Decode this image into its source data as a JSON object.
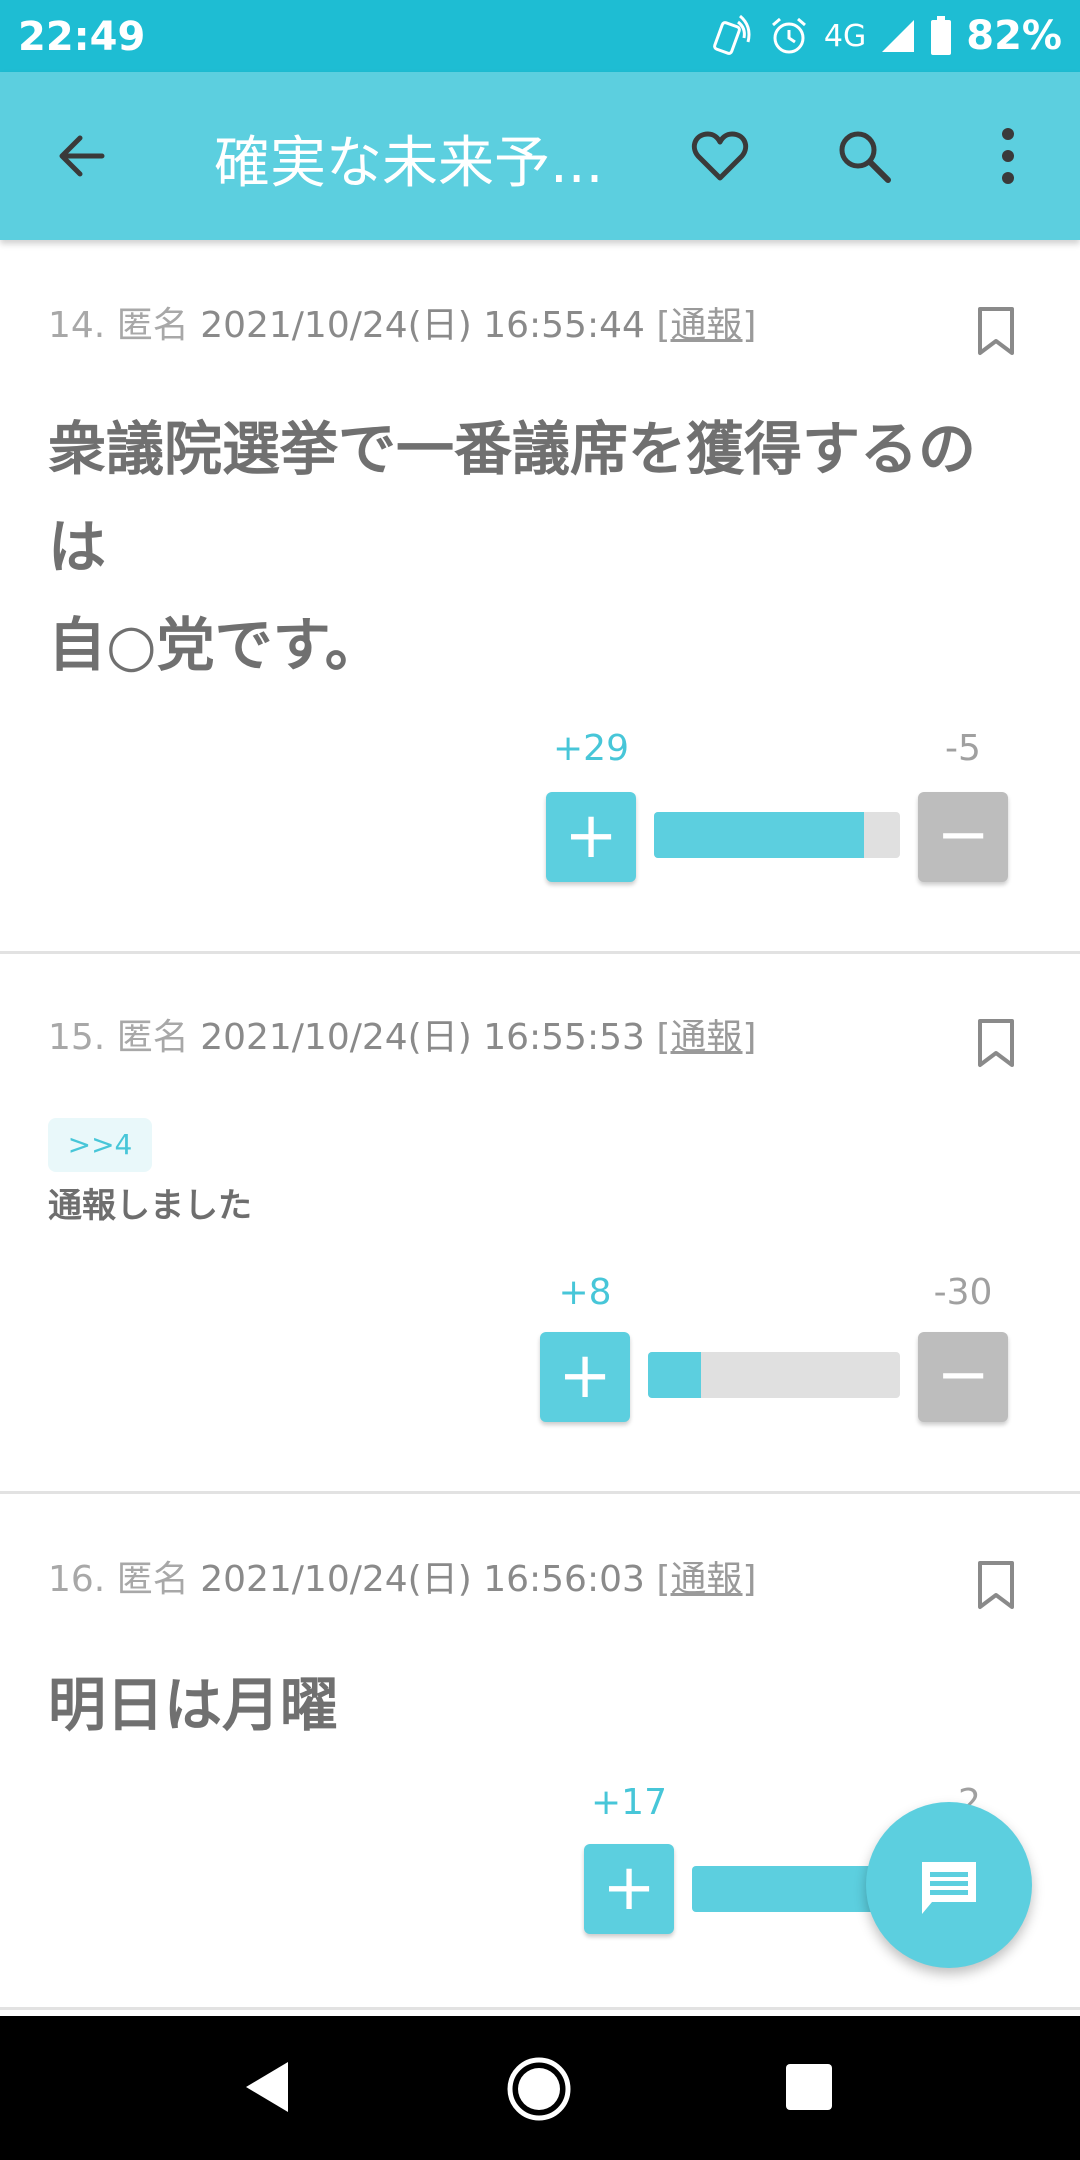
{
  "status_bar": {
    "time": "22:49",
    "network": "4G",
    "battery": "82%"
  },
  "app_bar": {
    "title": "確実な未来予..."
  },
  "posts": [
    {
      "number": "14.",
      "author": "匿名",
      "datetime": "2021/10/24(日) 16:55:44",
      "report": "[通報]",
      "lines": [
        "衆議院選挙で一番議席を獲得するの",
        "は",
        "自○党です。"
      ],
      "plus": "+29",
      "minus": "-5",
      "plus_fraction": 0.853
    },
    {
      "number": "15.",
      "author": "匿名",
      "datetime": "2021/10/24(日) 16:55:53",
      "report": "[通報]",
      "reply_anchor": ">>4",
      "text": "通報しました",
      "plus": "+8",
      "minus": "-30",
      "plus_fraction": 0.21
    },
    {
      "number": "16.",
      "author": "匿名",
      "datetime": "2021/10/24(日) 16:56:03",
      "report": "[通報]",
      "text": "明日は月曜",
      "plus": "+17",
      "minus": "-2"
    }
  ],
  "colors": {
    "accent": "#5ccfdf",
    "status_bar": "#1ebdd3",
    "minus_button": "#bdbdbd"
  }
}
